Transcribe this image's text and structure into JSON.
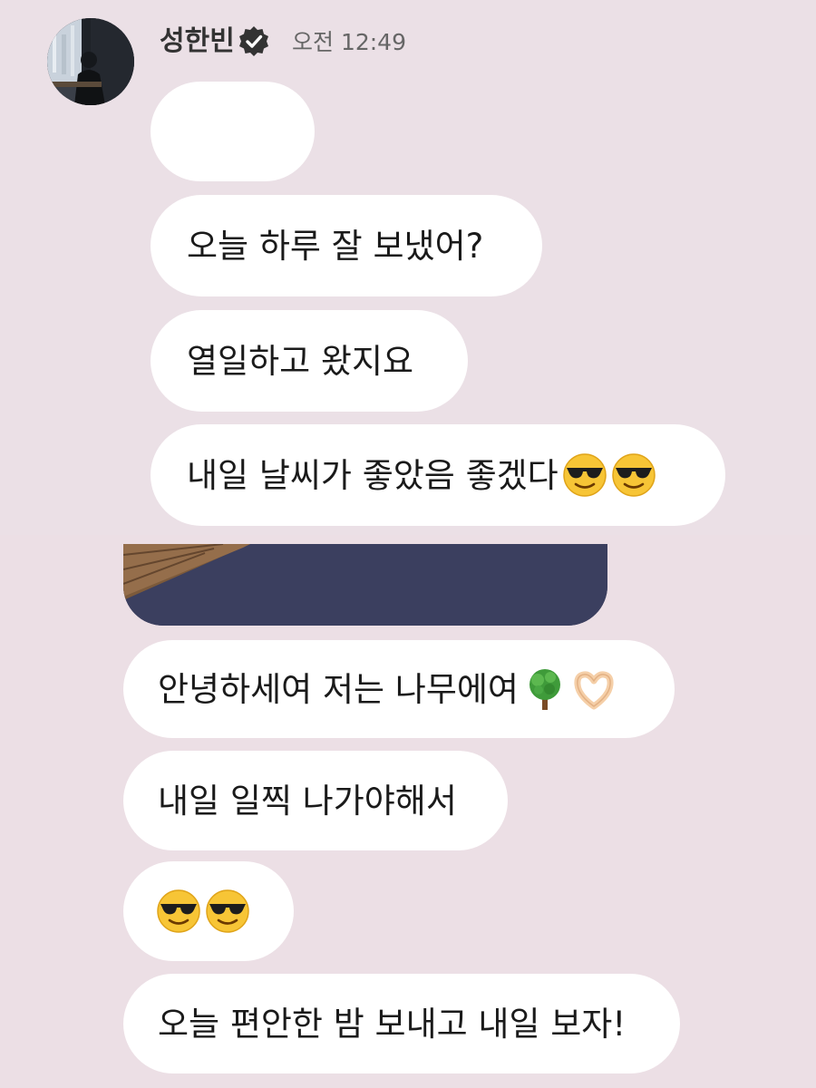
{
  "chat": {
    "sender": {
      "name": "성한빈",
      "time": "오전 12:49"
    },
    "messages": [
      {
        "text": ""
      },
      {
        "text": "오늘 하루 잘 보냈어?"
      },
      {
        "text": "열일하고 왔지요"
      },
      {
        "text": "내일 날씨가 좋았음 좋겠다",
        "emoji": [
          "sunglasses-face",
          "sunglasses-face"
        ]
      },
      {
        "type": "photo"
      },
      {
        "text": "안녕하세여 저는 나무에여",
        "emoji": [
          "tree",
          "heart-hands"
        ]
      },
      {
        "text": "내일 일찍 나가야해서"
      },
      {
        "text": "",
        "emoji": [
          "sunglasses-face",
          "sunglasses-face"
        ]
      },
      {
        "text": "오늘 편안한 밤 보내고 내일 보자!"
      }
    ]
  },
  "colors": {
    "background": "#ece2e8",
    "bubble": "#ffffff",
    "text": "#1a1a1a",
    "verified_badge": "#333333"
  }
}
